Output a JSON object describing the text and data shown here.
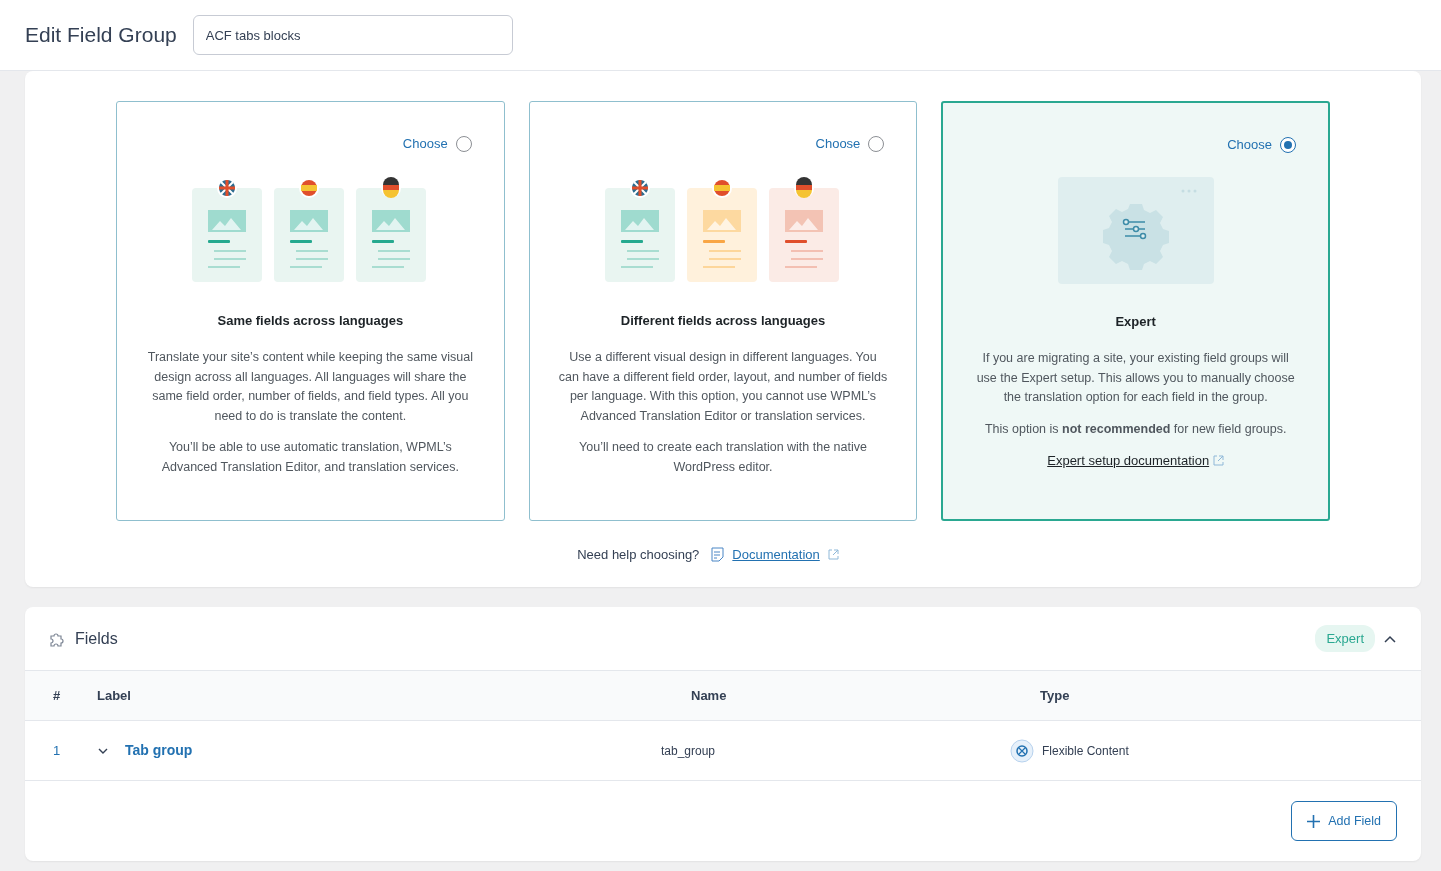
{
  "header": {
    "title": "Edit Field Group",
    "group_title": "ACF tabs blocks"
  },
  "options": [
    {
      "kind": "same",
      "choose_label": "Choose",
      "selected": false,
      "title": "Same fields across languages",
      "paragraphs": [
        "Translate your site’s content while keeping the same visual design across all languages. All languages will share the same field order, number of fields, and field types. All you need to do is translate the content.",
        "You’ll be able to use automatic translation, WPML’s Advanced Translation Editor, and translation services."
      ]
    },
    {
      "kind": "different",
      "choose_label": "Choose",
      "selected": false,
      "title": "Different fields across languages",
      "paragraphs": [
        "Use a different visual design in different languages. You can have a different field order, layout, and number of fields per language. With this option, you cannot use WPML’s Advanced Translation Editor or translation services.",
        "You’ll need to create each translation with the native WordPress editor."
      ]
    },
    {
      "kind": "expert",
      "choose_label": "Choose",
      "selected": true,
      "title": "Expert",
      "paragraphs": [
        "If you are migrating a site, your existing field groups will use the Expert setup. This allows you to manually choose the translation option for each field in the group.",
        "This option is **not recommended** for new field groups."
      ],
      "link": "Expert setup documentation"
    }
  ],
  "help": {
    "text": "Need help choosing?",
    "link": "Documentation"
  },
  "fields_panel": {
    "title": "Fields",
    "badge": "Expert",
    "expanded": true,
    "columns": [
      "#",
      "Label",
      "Name",
      "Type"
    ],
    "rows": [
      {
        "number": "1",
        "expanded": false,
        "label": "Tab group",
        "name": "tab_group",
        "type": "Flexible Content"
      }
    ],
    "add_button": "Add Field"
  }
}
